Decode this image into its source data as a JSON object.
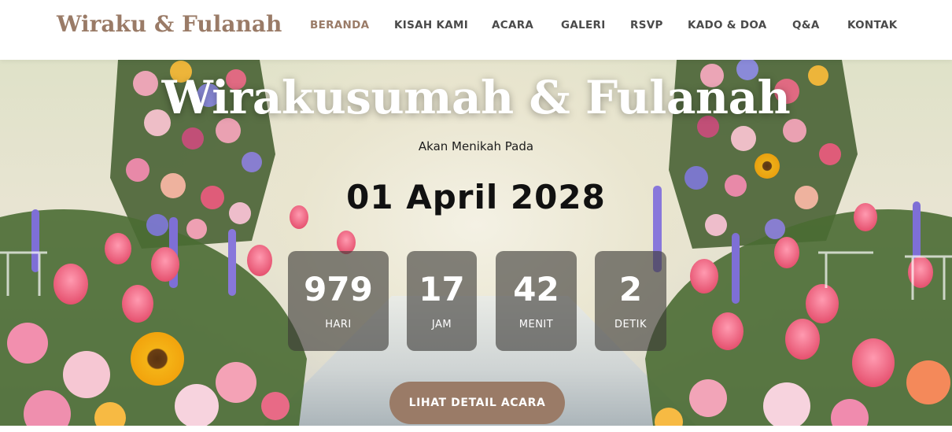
{
  "header": {
    "logo": "Wiraku & Fulanah",
    "nav": [
      {
        "label": "BERANDA",
        "active": true
      },
      {
        "label": "KISAH KAMI"
      },
      {
        "label": "ACARA"
      },
      {
        "label": "GALERI"
      },
      {
        "label": "RSVP"
      },
      {
        "label": "KADO & DOA"
      },
      {
        "label": "Q&A"
      },
      {
        "label": "KONTAK"
      }
    ]
  },
  "hero": {
    "title": "Wirakusumah & Fulanah",
    "subtitle": "Akan Menikah Pada",
    "date": "01 April 2028",
    "countdown": {
      "days": {
        "value": "979",
        "label": "HARI"
      },
      "hours": {
        "value": "17",
        "label": "JAM"
      },
      "minutes": {
        "value": "42",
        "label": "MENIT"
      },
      "seconds": {
        "value": "2",
        "label": "DETIK"
      }
    },
    "cta": "LIHAT DETAIL ACARA"
  },
  "colors": {
    "accent": "#9a7b67",
    "nav_text": "#4a4a4a",
    "countdown_bg": "#3c3a37"
  }
}
